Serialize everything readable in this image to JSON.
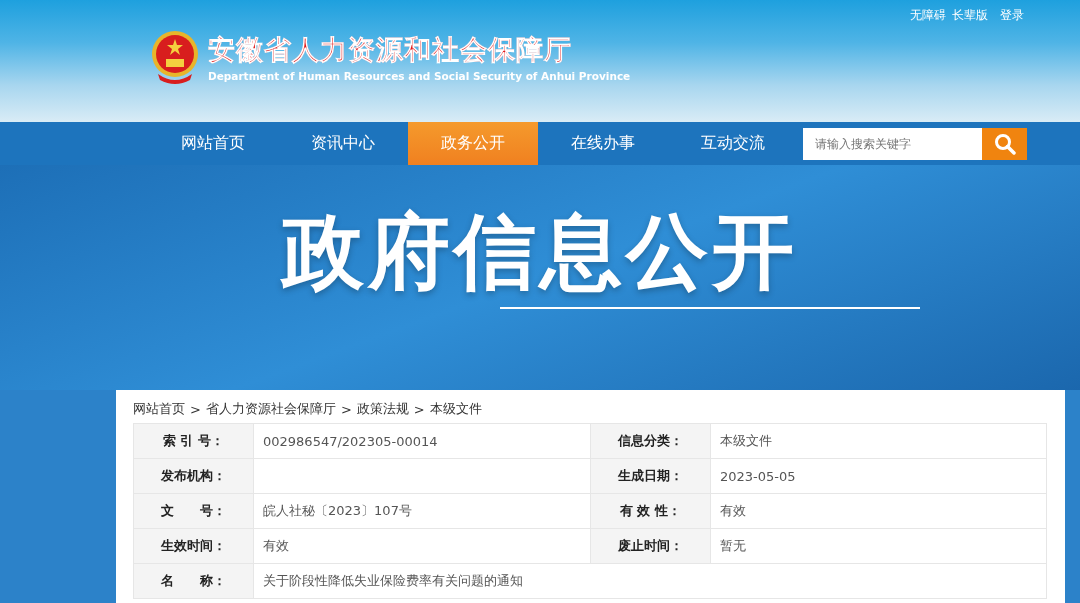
{
  "top_links": [
    "无障碍",
    "长辈版",
    "登录"
  ],
  "site": {
    "title": "安徽省人力资源和社会保障厅",
    "subtitle": "Department of Human Resources and Social Security of Anhui Province"
  },
  "nav": [
    {
      "label": "网站首页",
      "selected": false
    },
    {
      "label": "资讯中心",
      "selected": false
    },
    {
      "label": "政务公开",
      "selected": true
    },
    {
      "label": "在线办事",
      "selected": false
    },
    {
      "label": "互动交流",
      "selected": false
    }
  ],
  "search": {
    "placeholder": "请输入搜索关键字"
  },
  "banner": {
    "title": "政府信息公开"
  },
  "breadcrumb": {
    "items": [
      "网站首页",
      "省人力资源社会保障厅",
      "政策法规",
      "本级文件"
    ],
    "separator": ">"
  },
  "meta_rows": [
    [
      {
        "label": "索 引 号：",
        "value": "002986547/202305-00014"
      },
      {
        "label": "信息分类：",
        "value": "本级文件"
      }
    ],
    [
      {
        "label": "发布机构："
      },
      {
        "label": "生成日期：",
        "value": "2023-05-05"
      }
    ],
    [
      {
        "label": "文　　号：",
        "value": "皖人社秘〔2023〕107号"
      },
      {
        "label": "有 效 性：",
        "value": "有效"
      }
    ],
    [
      {
        "label": "生效时间：",
        "value": "有效"
      },
      {
        "label": "废止时间：",
        "value": "暂无"
      }
    ],
    [
      {
        "label": "名　　称：",
        "value": "关于阶段性降低失业保险费率有关问题的通知"
      }
    ]
  ]
}
